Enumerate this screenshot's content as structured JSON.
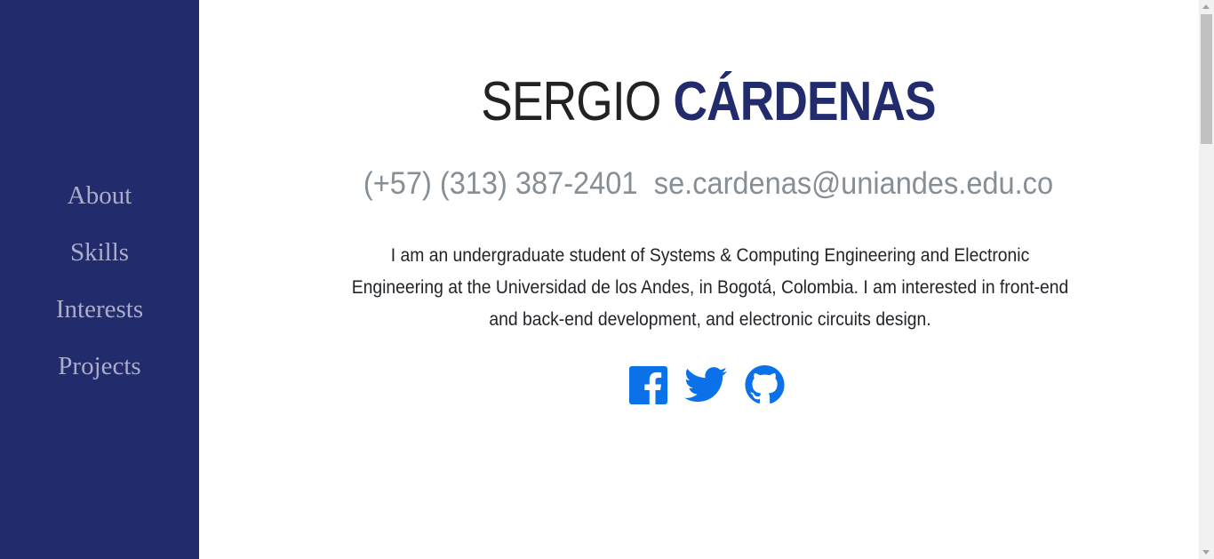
{
  "colors": {
    "sidebar_bg": "#222c6c",
    "nav_text": "#a9adc9",
    "accent": "#222c6c",
    "muted": "#868e96",
    "social_icon": "#0a71e8"
  },
  "sidebar": {
    "nav": [
      {
        "label": "About"
      },
      {
        "label": "Skills"
      },
      {
        "label": "Interests"
      },
      {
        "label": "Projects"
      }
    ]
  },
  "header": {
    "first_name": "SERGIO",
    "last_name": "CÁRDENAS",
    "phone": "(+57) (313) 387-2401",
    "email": "se.cardenas@uniandes.edu.co"
  },
  "bio": "I am an undergraduate student of Systems & Computing Engineering and Electronic Engineering at the Universidad de los Andes, in Bogotá, Colombia. I am interested in front-end and back-end development, and electronic circuits design.",
  "social": [
    {
      "icon": "facebook-icon"
    },
    {
      "icon": "twitter-icon"
    },
    {
      "icon": "github-icon"
    }
  ]
}
